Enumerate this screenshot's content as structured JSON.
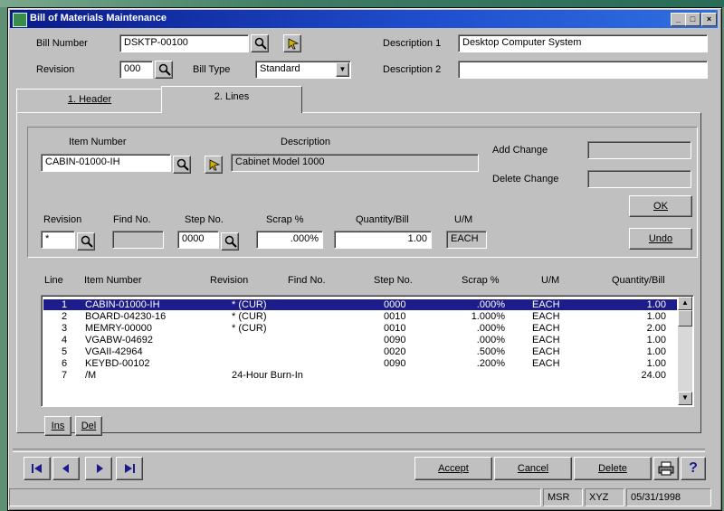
{
  "window": {
    "title": "Bill of Materials Maintenance"
  },
  "header": {
    "bill_number_label": "Bill Number",
    "bill_number_value": "DSKTP-00100",
    "revision_label": "Revision",
    "revision_value": "000",
    "bill_type_label": "Bill Type",
    "bill_type_value": "Standard",
    "description1_label": "Description 1",
    "description1_value": "Desktop Computer System",
    "description2_label": "Description 2",
    "description2_value": ""
  },
  "tabs": [
    {
      "label": "1. Header"
    },
    {
      "label": "2. Lines"
    }
  ],
  "lines_form": {
    "item_number_label": "Item Number",
    "item_number_value": "CABIN-01000-IH",
    "description_label": "Description",
    "description_value": "Cabinet Model 1000",
    "add_change_label": "Add Change",
    "add_change_value": "",
    "delete_change_label": "Delete Change",
    "delete_change_value": "",
    "revision_label": "Revision",
    "revision_value": "*",
    "find_no_label": "Find No.",
    "find_no_value": "",
    "step_no_label": "Step No.",
    "step_no_value": "0000",
    "scrap_label": "Scrap %",
    "scrap_value": ".000%",
    "qty_label": "Quantity/Bill",
    "qty_value": "1.00",
    "um_label": "U/M",
    "um_value": "EACH",
    "ok_label": "OK",
    "undo_label": "Undo"
  },
  "grid": {
    "columns": [
      "Line",
      "Item Number",
      "Revision",
      "Find No.",
      "Step No.",
      "Scrap %",
      "U/M",
      "Quantity/Bill"
    ],
    "rows": [
      {
        "line": "1",
        "item": "CABIN-01000-IH",
        "rev": "*  (CUR)",
        "find": "",
        "step": "0000",
        "scrap": ".000%",
        "um": "EACH",
        "qty": "1.00"
      },
      {
        "line": "2",
        "item": "BOARD-04230-16",
        "rev": "*  (CUR)",
        "find": "",
        "step": "0010",
        "scrap": "1.000%",
        "um": "EACH",
        "qty": "1.00"
      },
      {
        "line": "3",
        "item": "MEMRY-00000",
        "rev": "*  (CUR)",
        "find": "",
        "step": "0010",
        "scrap": ".000%",
        "um": "EACH",
        "qty": "2.00"
      },
      {
        "line": "4",
        "item": "VGABW-04692",
        "rev": "",
        "find": "",
        "step": "0090",
        "scrap": ".000%",
        "um": "EACH",
        "qty": "1.00"
      },
      {
        "line": "5",
        "item": "VGAII-42964",
        "rev": "",
        "find": "",
        "step": "0020",
        "scrap": ".500%",
        "um": "EACH",
        "qty": "1.00"
      },
      {
        "line": "6",
        "item": "KEYBD-00102",
        "rev": "",
        "find": "",
        "step": "0090",
        "scrap": ".200%",
        "um": "EACH",
        "qty": "1.00"
      },
      {
        "line": "7",
        "item": "/M",
        "rev": "24-Hour Burn-In",
        "find": "",
        "step": "",
        "scrap": "",
        "um": "",
        "qty": "24.00"
      }
    ],
    "ins_label": "Ins",
    "del_label": "Del"
  },
  "footer": {
    "accept_label": "Accept",
    "cancel_label": "Cancel",
    "delete_label": "Delete",
    "help_label": "?"
  },
  "status": {
    "user": "MSR",
    "company": "XYZ",
    "date": "05/31/1998"
  },
  "colors": {
    "title_bar": "#0a1a8a",
    "selection": "#1c1c8c",
    "face": "#c0c0c0"
  }
}
